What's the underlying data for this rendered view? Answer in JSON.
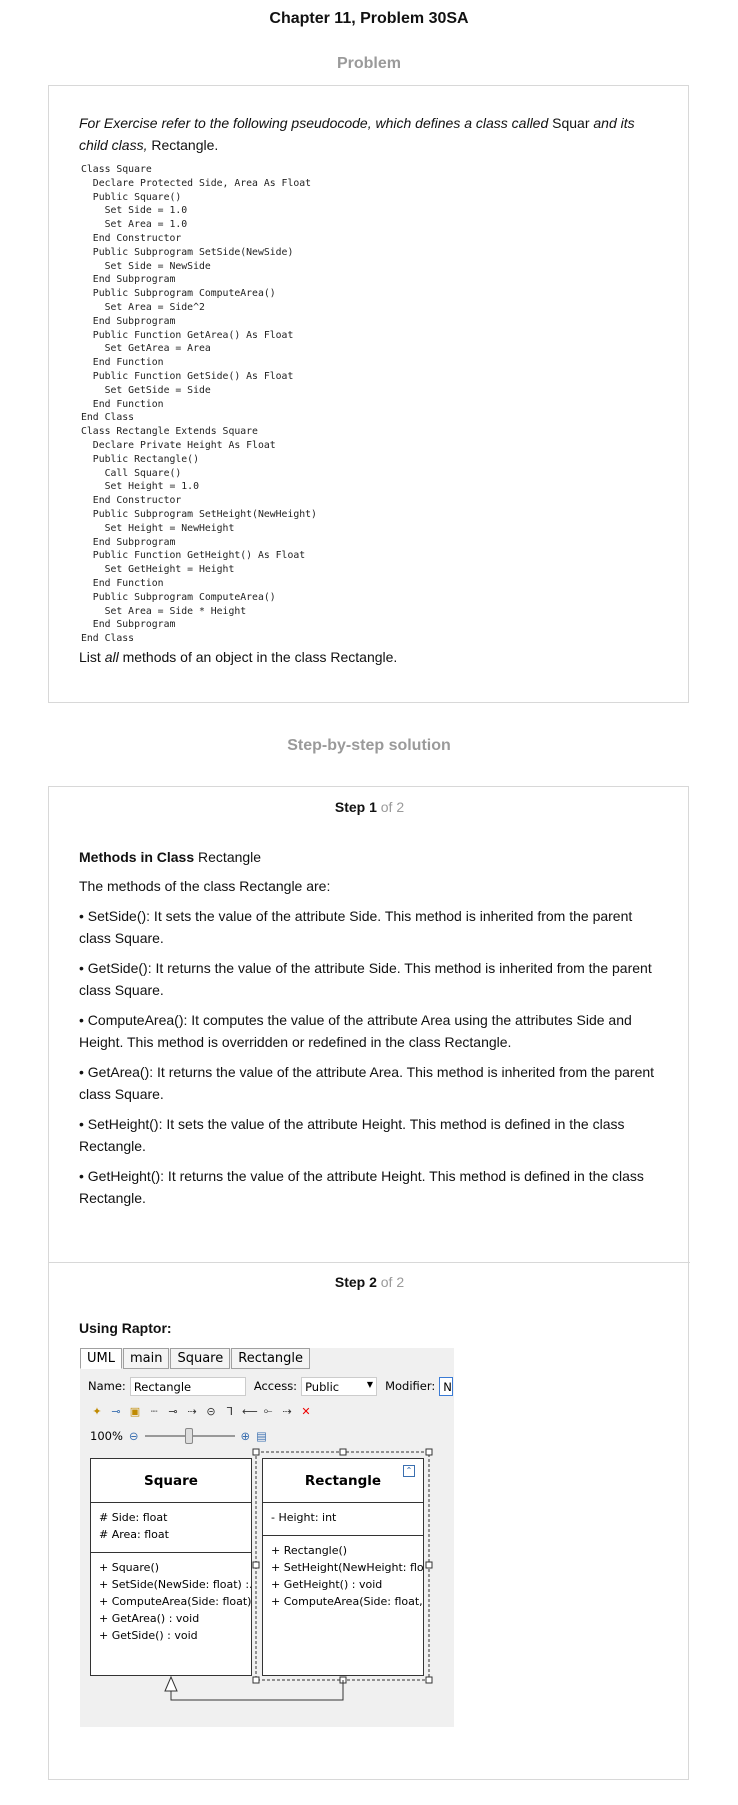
{
  "page_title": "Chapter 11, Problem 30SA",
  "problem": {
    "section_title": "Problem",
    "intro_italic_1": "For Exercise refer to the following pseudocode, which defines a class called ",
    "intro_class_1": "Squar",
    "intro_italic_2": " and its child class, ",
    "intro_class_2": "Rectangle",
    "intro_end": ".",
    "code": "Class Square\n  Declare Protected Side, Area As Float\n  Public Square()\n    Set Side = 1.0\n    Set Area = 1.0\n  End Constructor\n  Public Subprogram SetSide(NewSide)\n    Set Side = NewSide\n  End Subprogram\n  Public Subprogram ComputeArea()\n    Set Area = Side^2\n  End Subprogram\n  Public Function GetArea() As Float\n    Set GetArea = Area\n  End Function\n  Public Function GetSide() As Float\n    Set GetSide = Side\n  End Function\nEnd Class\nClass Rectangle Extends Square\n  Declare Private Height As Float\n  Public Rectangle()\n    Call Square()\n    Set Height = 1.0\n  End Constructor\n  Public Subprogram SetHeight(NewHeight)\n    Set Height = NewHeight\n  End Subprogram\n  Public Function GetHeight() As Float\n    Set GetHeight = Height\n  End Function\n  Public Subprogram ComputeArea()\n    Set Area = Side * Height\n  End Subprogram\nEnd Class",
    "question_pre": "List ",
    "question_em": "all",
    "question_post": " methods of an object in the class Rectangle."
  },
  "solution": {
    "section_title": "Step-by-step solution",
    "step1": {
      "label": "Step 1",
      "of": "of 2",
      "subtitle_bold": "Methods in Class",
      "subtitle_rest": " Rectangle",
      "paragraphs": [
        "The methods of the class Rectangle are:",
        "• SetSide(): It sets the value of the attribute Side. This method is inherited from the parent class Square.",
        "• GetSide(): It returns the value of the attribute Side. This method is inherited from the parent class Square.",
        "• ComputeArea(): It computes the value of the attribute Area using the attributes Side and Height. This method is overridden or redefined in the class Rectangle.",
        "• GetArea(): It returns the value of the attribute Area. This method is inherited from the parent class Square.",
        "• SetHeight(): It sets the value of the attribute Height. This method is defined in the class Rectangle.",
        "• GetHeight(): It returns the value of the attribute Height. This method is defined in the class Rectangle."
      ]
    },
    "step2": {
      "label": "Step 2",
      "of": "of 2",
      "subtitle": "Using Raptor:"
    }
  },
  "raptor": {
    "tabs": [
      "UML",
      "main",
      "Square",
      "Rectangle"
    ],
    "name_label": "Name:",
    "name_value": "Rectangle",
    "access_label": "Access:",
    "access_value": "Public",
    "modifier_label": "Modifier:",
    "modifier_value": "N",
    "zoom": "100%",
    "square": {
      "name": "Square",
      "attrs": [
        "# Side: float",
        "# Area: float"
      ],
      "ops": [
        "+ Square()",
        "+ SetSide(NewSide: float) :...",
        "+ ComputeArea(Side: float)...",
        "+ GetArea() : void",
        "+ GetSide() : void"
      ]
    },
    "rectangle": {
      "name": "Rectangle",
      "attrs": [
        "- Height: int"
      ],
      "ops": [
        "+ Rectangle()",
        "+ SetHeight(NewHeight: flo...",
        "+ GetHeight() : void",
        "+ ComputeArea(Side: float,..."
      ]
    }
  }
}
